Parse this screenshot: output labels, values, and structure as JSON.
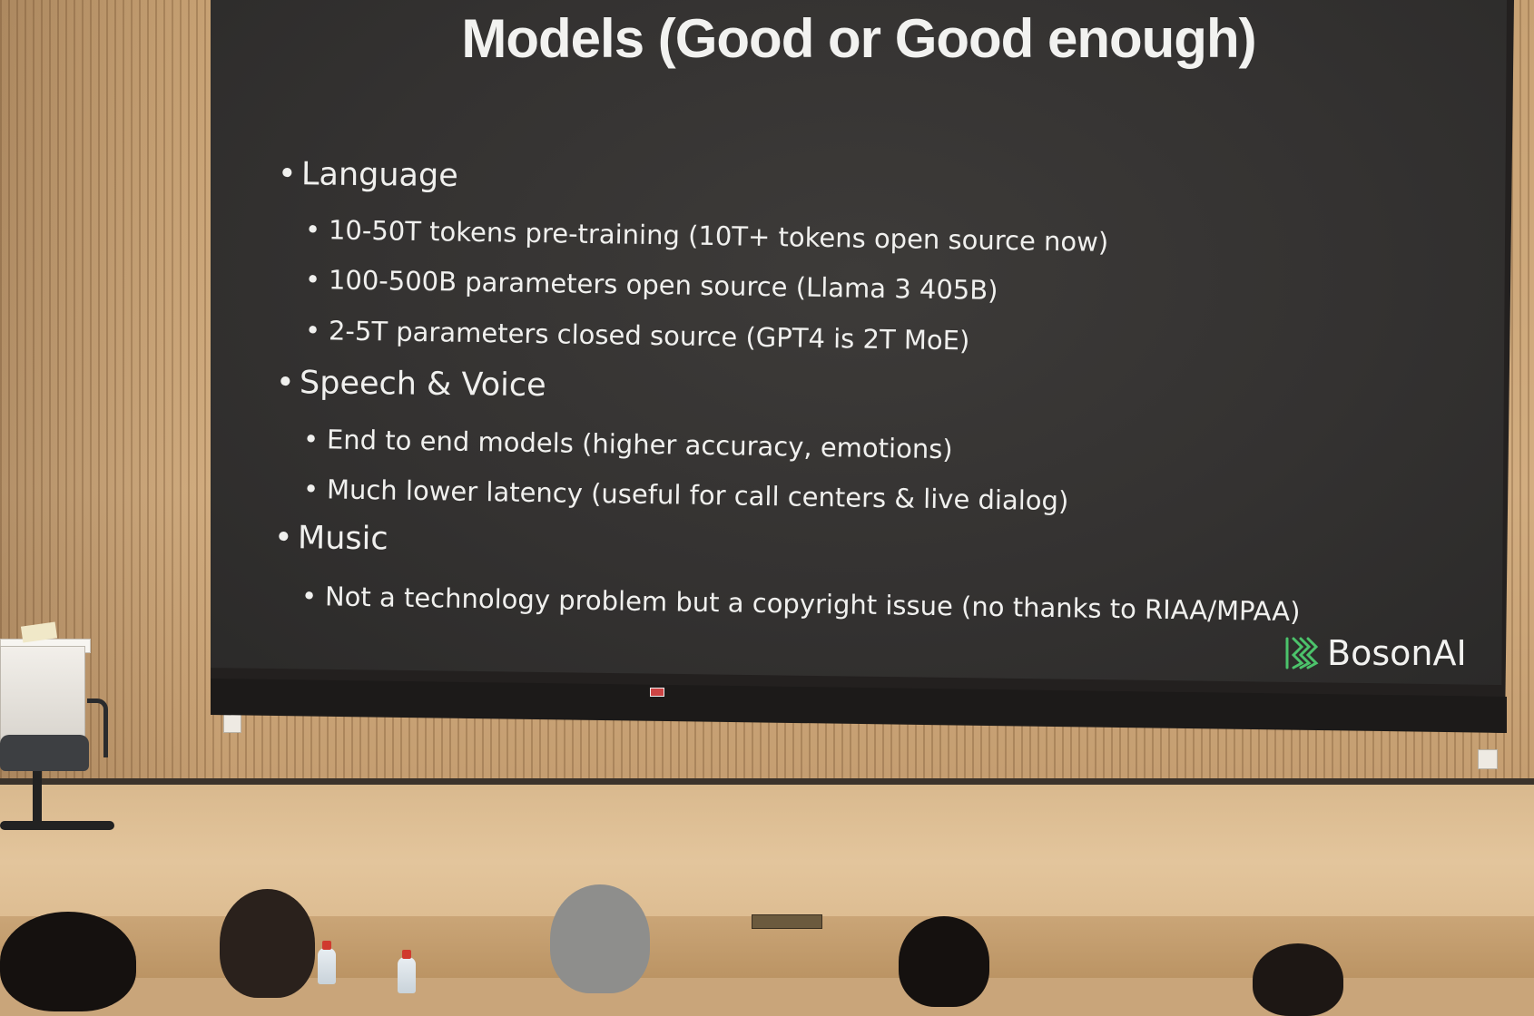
{
  "slide": {
    "title": "Models (Good or Good enough)",
    "sections": [
      {
        "heading": "Language",
        "items": [
          "10-50T tokens pre-training (10T+ tokens open source now)",
          "100-500B parameters open source (Llama 3 405B)",
          "2-5T parameters closed source (GPT4 is 2T MoE)"
        ]
      },
      {
        "heading": "Speech & Voice",
        "items": [
          "End to end models (higher accuracy, emotions)",
          "Much lower latency (useful for call centers & live dialog)"
        ]
      },
      {
        "heading": "Music",
        "items": [
          "Not a technology problem but a copyright issue (no thanks to RIAA/MPAA)"
        ]
      }
    ],
    "logo_text": "BosonAI",
    "logo_icon": "boson-ai-logo-icon"
  },
  "colors": {
    "slide_background": "#363432",
    "slide_text": "#f0f0ee",
    "logo_accent": "#4cc36b",
    "wall_wood": "#c8a274"
  }
}
